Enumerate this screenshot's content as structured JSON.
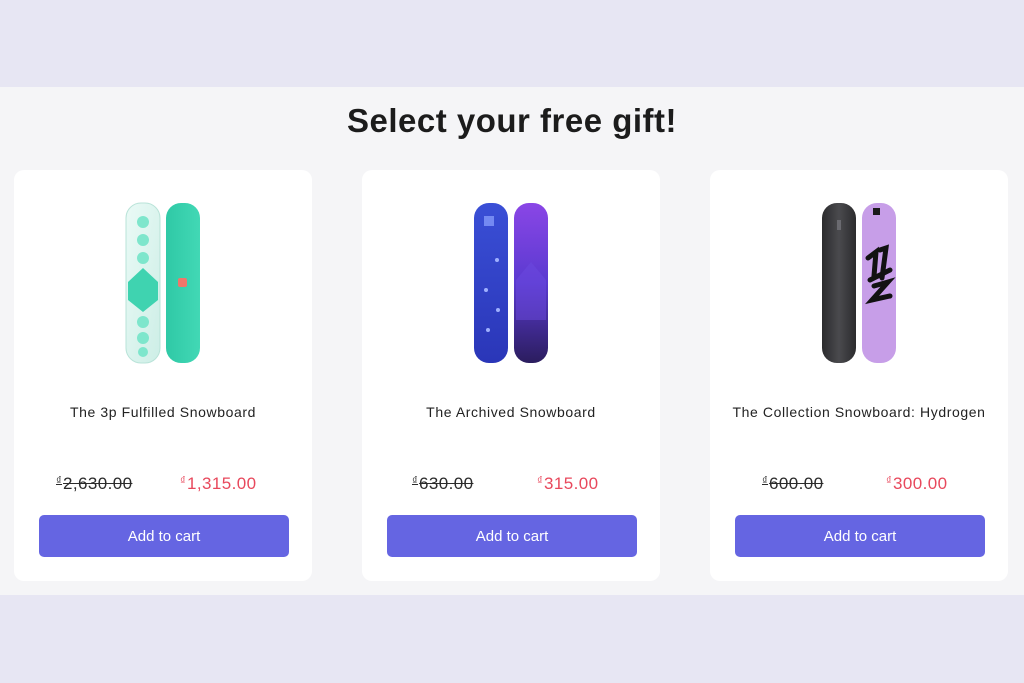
{
  "heading": "Select your free gift!",
  "currency_symbol": "₫",
  "products": [
    {
      "name": "The 3p Fulfilled Snowboard",
      "compare_price": "2,630.00",
      "price": "1,315.00",
      "button_label": "Add to cart"
    },
    {
      "name": "The Archived Snowboard",
      "compare_price": "630.00",
      "price": "315.00",
      "button_label": "Add to cart"
    },
    {
      "name": "The Collection Snowboard: Hydrogen",
      "compare_price": "600.00",
      "price": "300.00",
      "button_label": "Add to cart"
    }
  ],
  "colors": {
    "accent": "#6565e2",
    "sale_price": "#e8485c",
    "page_bg": "#e7e6f3"
  }
}
